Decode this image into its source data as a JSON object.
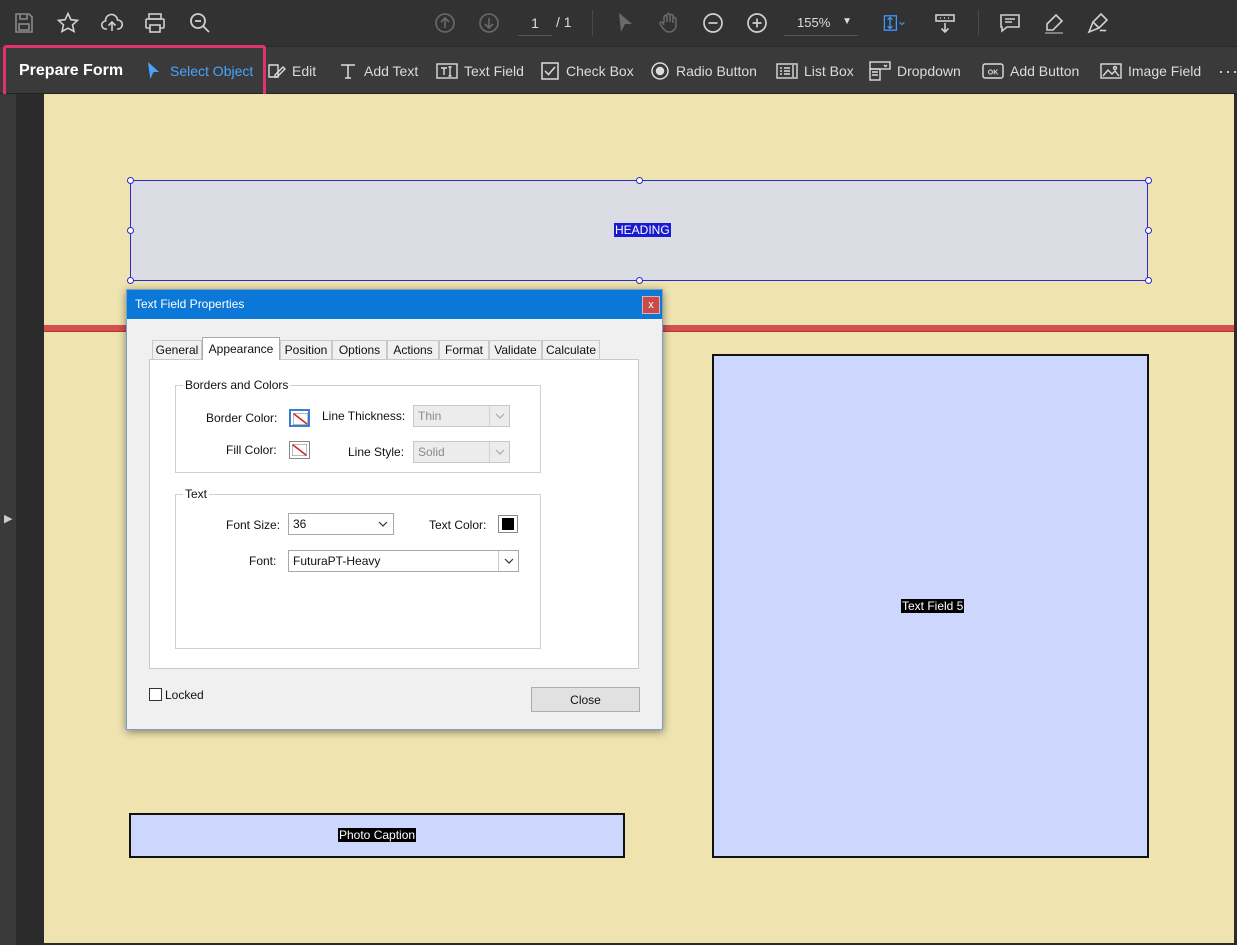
{
  "top_toolbar": {
    "icons": [
      "save-icon",
      "bookmark-star-icon",
      "upload-cloud-icon",
      "print-icon",
      "search-icon",
      "prev-page-icon",
      "next-page-icon",
      "select-cursor-icon",
      "hand-icon",
      "zoom-out-icon",
      "zoom-in-icon",
      "fit-page-icon",
      "scroll-mode-icon",
      "comment-icon",
      "highlight-icon",
      "sign-icon"
    ],
    "page_current": "1",
    "page_total": "/ 1",
    "zoom": "155%"
  },
  "form_toolbar": {
    "title": "Prepare Form",
    "items": [
      {
        "label": "Select Object",
        "active": true
      },
      {
        "label": "Edit"
      },
      {
        "label": "Add Text"
      },
      {
        "label": "Text Field"
      },
      {
        "label": "Check Box"
      },
      {
        "label": "Radio Button"
      },
      {
        "label": "List Box"
      },
      {
        "label": "Dropdown"
      },
      {
        "label": "Add Button"
      },
      {
        "label": "Image Field"
      }
    ],
    "highlight_color": "#e0336c"
  },
  "page": {
    "background": "#efe3b0",
    "fields": {
      "heading": "HEADING",
      "text_field_5": "Text Field 5",
      "photo_caption": "Photo Caption"
    }
  },
  "dialog": {
    "title": "Text Field Properties",
    "close_x": "x",
    "tabs": [
      "General",
      "Appearance",
      "Position",
      "Options",
      "Actions",
      "Format",
      "Validate",
      "Calculate"
    ],
    "active_tab": "Appearance",
    "borders_group": {
      "title": "Borders and Colors",
      "border_color_label": "Border Color:",
      "fill_color_label": "Fill Color:",
      "line_thickness_label": "Line Thickness:",
      "line_thickness_value": "Thin",
      "line_style_label": "Line Style:",
      "line_style_value": "Solid"
    },
    "text_group": {
      "title": "Text",
      "font_size_label": "Font Size:",
      "font_size_value": "36",
      "text_color_label": "Text Color:",
      "font_label": "Font:",
      "font_value": "FuturaPT-Heavy"
    },
    "locked_label": "Locked",
    "close_button": "Close"
  }
}
